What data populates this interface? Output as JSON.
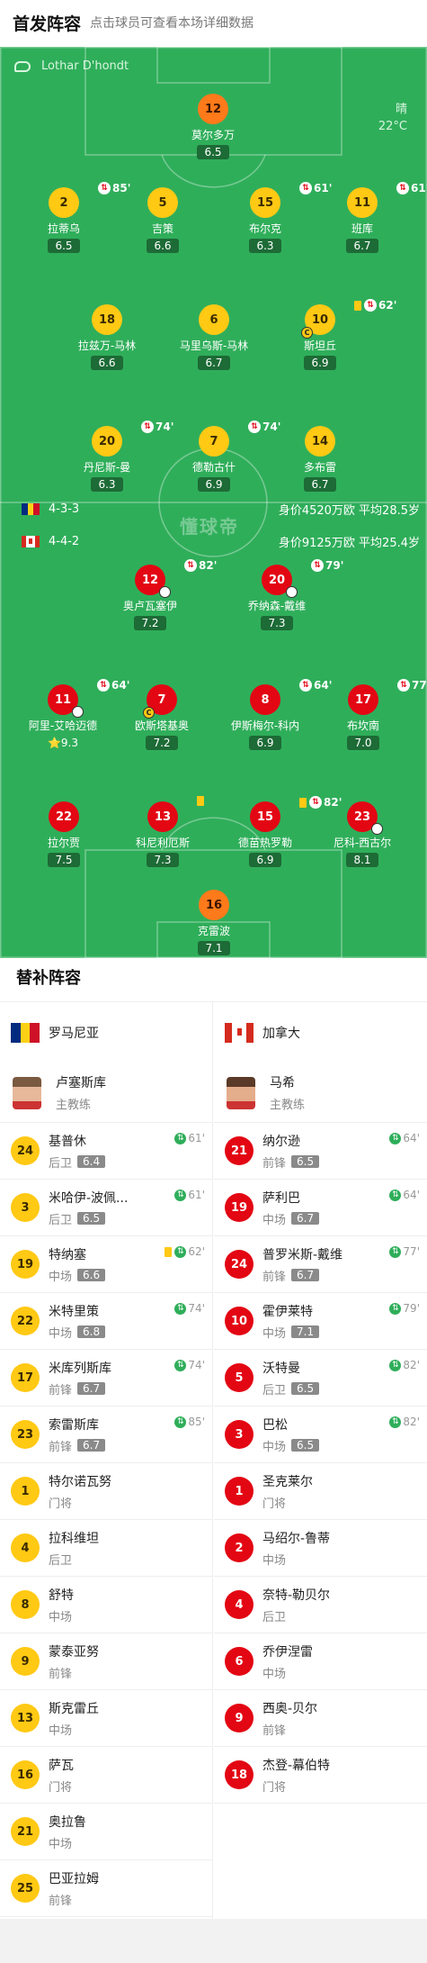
{
  "header": {
    "title": "首发阵容",
    "subtitle": "点击球员可查看本场详细数据"
  },
  "pitch": {
    "referee": "Lothar D'hondt",
    "weather": "晴",
    "temperature": "22°C",
    "watermark": "懂球帝"
  },
  "teams": {
    "home": {
      "formation": "4-3-3",
      "info": "身价4520万欧 平均28.5岁",
      "flag": "romania-flag"
    },
    "away": {
      "formation": "4-4-2",
      "info": "身价9125万欧 平均25.4岁",
      "flag": "canada-flag"
    }
  },
  "home_players": [
    {
      "num": "12",
      "name": "莫尔多万",
      "rating": "6.5",
      "color": "o"
    },
    {
      "num": "2",
      "name": "拉蒂乌",
      "rating": "6.5",
      "sub_min": "85'",
      "color": "y"
    },
    {
      "num": "5",
      "name": "吉策",
      "rating": "6.6",
      "color": "y"
    },
    {
      "num": "15",
      "name": "布尔克",
      "rating": "6.3",
      "sub_min": "61'",
      "color": "y"
    },
    {
      "num": "11",
      "name": "班库",
      "rating": "6.7",
      "sub_min": "61'",
      "color": "y"
    },
    {
      "num": "18",
      "name": "拉兹万-马林",
      "rating": "6.6",
      "color": "y"
    },
    {
      "num": "6",
      "name": "马里乌斯-马林",
      "rating": "6.7",
      "color": "y"
    },
    {
      "num": "10",
      "name": "斯坦丘",
      "rating": "6.9",
      "sub_min": "62'",
      "color": "y"
    },
    {
      "num": "20",
      "name": "丹尼斯-曼",
      "rating": "6.3",
      "sub_min": "74'",
      "color": "y"
    },
    {
      "num": "7",
      "name": "德勒古什",
      "rating": "6.9",
      "sub_min": "74'",
      "color": "y"
    },
    {
      "num": "14",
      "name": "多布雷",
      "rating": "6.7",
      "color": "y"
    }
  ],
  "away_players": [
    {
      "num": "12",
      "name": "奥卢瓦塞伊",
      "rating": "7.2",
      "sub_min": "82'",
      "color": "r"
    },
    {
      "num": "20",
      "name": "乔纳森-戴维",
      "rating": "7.3",
      "sub_min": "79'",
      "color": "r"
    },
    {
      "num": "11",
      "name": "阿里-艾哈迈德",
      "rating": "9.3",
      "sub_min": "64'",
      "color": "r"
    },
    {
      "num": "7",
      "name": "欧斯塔基奥",
      "rating": "7.2",
      "color": "r"
    },
    {
      "num": "8",
      "name": "伊斯梅尔-科内",
      "rating": "6.9",
      "sub_min": "64'",
      "color": "r"
    },
    {
      "num": "17",
      "name": "布坎南",
      "rating": "7.0",
      "sub_min": "77'",
      "color": "r"
    },
    {
      "num": "22",
      "name": "拉尔贾",
      "rating": "7.5",
      "color": "r"
    },
    {
      "num": "13",
      "name": "科尼利厄斯",
      "rating": "7.3",
      "color": "r"
    },
    {
      "num": "15",
      "name": "德苗热罗勒",
      "rating": "6.9",
      "sub_min": "82'",
      "color": "r"
    },
    {
      "num": "23",
      "name": "尼科-西古尔",
      "rating": "8.1",
      "color": "r"
    },
    {
      "num": "16",
      "name": "克雷波",
      "rating": "7.1",
      "color": "o"
    }
  ],
  "subs": {
    "title": "替补阵容",
    "home": {
      "team": "罗马尼亚",
      "coach_name": "卢塞斯库",
      "coach_role": "主教练",
      "players": [
        {
          "num": "24",
          "name": "基普休",
          "pos": "后卫",
          "rating": "6.4",
          "in": "61'"
        },
        {
          "num": "3",
          "name": "米哈伊-波佩...",
          "pos": "后卫",
          "rating": "6.5",
          "in": "61'"
        },
        {
          "num": "19",
          "name": "特纳塞",
          "pos": "中场",
          "rating": "6.6",
          "in": "62'",
          "ycard": true
        },
        {
          "num": "22",
          "name": "米特里策",
          "pos": "中场",
          "rating": "6.8",
          "in": "74'"
        },
        {
          "num": "17",
          "name": "米库列斯库",
          "pos": "前锋",
          "rating": "6.7",
          "in": "74'"
        },
        {
          "num": "23",
          "name": "索雷斯库",
          "pos": "前锋",
          "rating": "6.7",
          "in": "85'"
        },
        {
          "num": "1",
          "name": "特尔诺瓦努",
          "pos": "门将"
        },
        {
          "num": "4",
          "name": "拉科维坦",
          "pos": "后卫"
        },
        {
          "num": "8",
          "name": "舒特",
          "pos": "中场"
        },
        {
          "num": "9",
          "name": "蒙泰亚努",
          "pos": "前锋"
        },
        {
          "num": "13",
          "name": "斯克雷丘",
          "pos": "中场"
        },
        {
          "num": "16",
          "name": "萨瓦",
          "pos": "门将"
        },
        {
          "num": "21",
          "name": "奥拉鲁",
          "pos": "中场"
        },
        {
          "num": "25",
          "name": "巴亚拉姆",
          "pos": "前锋"
        }
      ]
    },
    "away": {
      "team": "加拿大",
      "coach_name": "马希",
      "coach_role": "主教练",
      "players": [
        {
          "num": "21",
          "name": "纳尔逊",
          "pos": "前锋",
          "rating": "6.5",
          "in": "64'"
        },
        {
          "num": "19",
          "name": "萨利巴",
          "pos": "中场",
          "rating": "6.7",
          "in": "64'"
        },
        {
          "num": "24",
          "name": "普罗米斯-戴维",
          "pos": "前锋",
          "rating": "6.7",
          "in": "77'"
        },
        {
          "num": "10",
          "name": "霍伊莱特",
          "pos": "中场",
          "rating": "7.1",
          "in": "79'"
        },
        {
          "num": "5",
          "name": "沃特曼",
          "pos": "后卫",
          "rating": "6.5",
          "in": "82'"
        },
        {
          "num": "3",
          "name": "巴松",
          "pos": "中场",
          "rating": "6.5",
          "in": "82'"
        },
        {
          "num": "1",
          "name": "圣克莱尔",
          "pos": "门将"
        },
        {
          "num": "2",
          "name": "马绍尔-鲁蒂",
          "pos": "中场"
        },
        {
          "num": "4",
          "name": "奈特-勒贝尔",
          "pos": "后卫"
        },
        {
          "num": "6",
          "name": "乔伊涅雷",
          "pos": "中场"
        },
        {
          "num": "9",
          "name": "西奥-贝尔",
          "pos": "前锋"
        },
        {
          "num": "18",
          "name": "杰登-幕伯特",
          "pos": "门将"
        }
      ]
    }
  }
}
